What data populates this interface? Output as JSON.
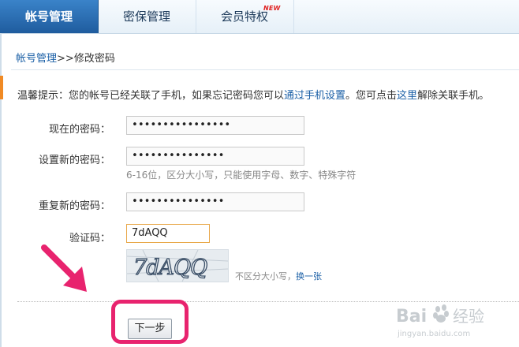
{
  "tabs": [
    {
      "label": "帐号管理",
      "active": true
    },
    {
      "label": "密保管理",
      "active": false
    },
    {
      "label": "会员特权",
      "active": false,
      "badge": "NEW"
    }
  ],
  "breadcrumb": {
    "link": "帐号管理",
    "separator": ">>",
    "current": "修改密码"
  },
  "tip": {
    "prefix": "温馨提示：您的帐号已经关联了手机，如果忘记密码您可以",
    "link1": "通过手机设置",
    "middle": "。您可点击",
    "link2": "这里",
    "suffix": "解除关联手机。"
  },
  "form": {
    "current_label": "现在的密码：",
    "current_value": "••••••••••••••••",
    "new_label": "设置新的密码：",
    "new_value": "•••••••••••••••",
    "new_hint": "6-16位，区分大小写，只能使用字母、数字、特殊字符",
    "repeat_label": "重复新的密码：",
    "repeat_value": "•••••••••••••••",
    "captcha_label": "验证码：",
    "captcha_value": "7dAQQ",
    "captcha_image_text": "7dAQQ",
    "captcha_note": "不区分大小写，",
    "captcha_refresh": "换一张"
  },
  "next_button": "下一步",
  "watermark": {
    "brand": "Bai",
    "brand2": "经验",
    "url": "jingyan.baidu.com"
  },
  "colors": {
    "accent_highlight": "#e8236e",
    "tab_active": "#2a6fb5",
    "link": "#1a5fa6"
  }
}
